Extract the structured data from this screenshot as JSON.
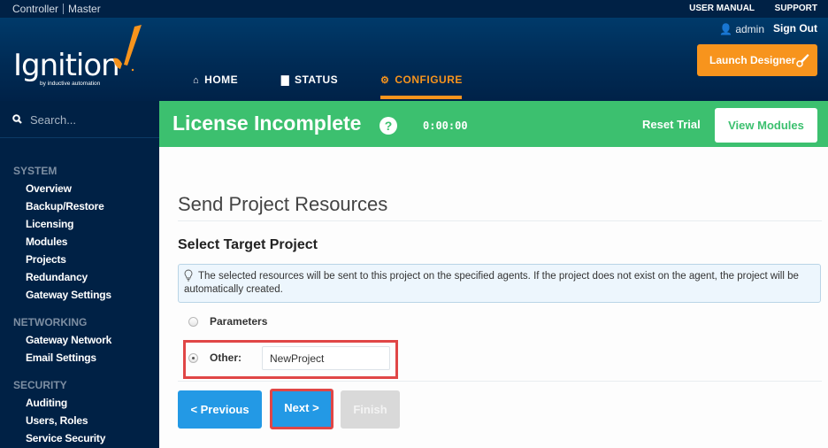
{
  "topbar": {
    "context": "Controller",
    "context_secondary": "Master",
    "links": [
      "USER MANUAL",
      "SUPPORT"
    ]
  },
  "header": {
    "logo_word": "Ignition",
    "logo_tagline": "by inductive automation",
    "nav": [
      {
        "label": "HOME",
        "icon": "home-icon",
        "active": false
      },
      {
        "label": "STATUS",
        "icon": "bar-chart-icon",
        "active": false
      },
      {
        "label": "CONFIGURE",
        "icon": "gear-icon",
        "active": true
      }
    ],
    "user": "admin",
    "sign_out": "Sign Out",
    "launch_designer": "Launch Designer"
  },
  "sidebar": {
    "search_placeholder": "Search...",
    "sections": [
      {
        "title": "SYSTEM",
        "items": [
          "Overview",
          "Backup/Restore",
          "Licensing",
          "Modules",
          "Projects",
          "Redundancy",
          "Gateway Settings"
        ]
      },
      {
        "title": "NETWORKING",
        "items": [
          "Gateway Network",
          "Email Settings"
        ]
      },
      {
        "title": "SECURITY",
        "items": [
          "Auditing",
          "Users, Roles",
          "Service Security"
        ]
      }
    ]
  },
  "banner": {
    "title": "License Incomplete",
    "help": "?",
    "timer": "0:00:00",
    "reset_trial": "Reset Trial",
    "view_modules": "View Modules"
  },
  "main": {
    "page_title": "Send Project Resources",
    "subtitle": "Select Target Project",
    "info": "The selected resources will be sent to this project on the specified agents. If the project does not exist on the agent, the project will be automatically created.",
    "options": [
      {
        "label": "Parameters",
        "checked": false
      },
      {
        "label": "Other:",
        "checked": true
      }
    ],
    "other_value": "NewProject",
    "buttons": {
      "previous": "< Previous",
      "next": "Next >",
      "finish": "Finish"
    }
  },
  "colors": {
    "navy": "#002145",
    "orange": "#f7941d",
    "green": "#3cc06f",
    "blue": "#2399e5",
    "highlight_red": "#e04646"
  }
}
